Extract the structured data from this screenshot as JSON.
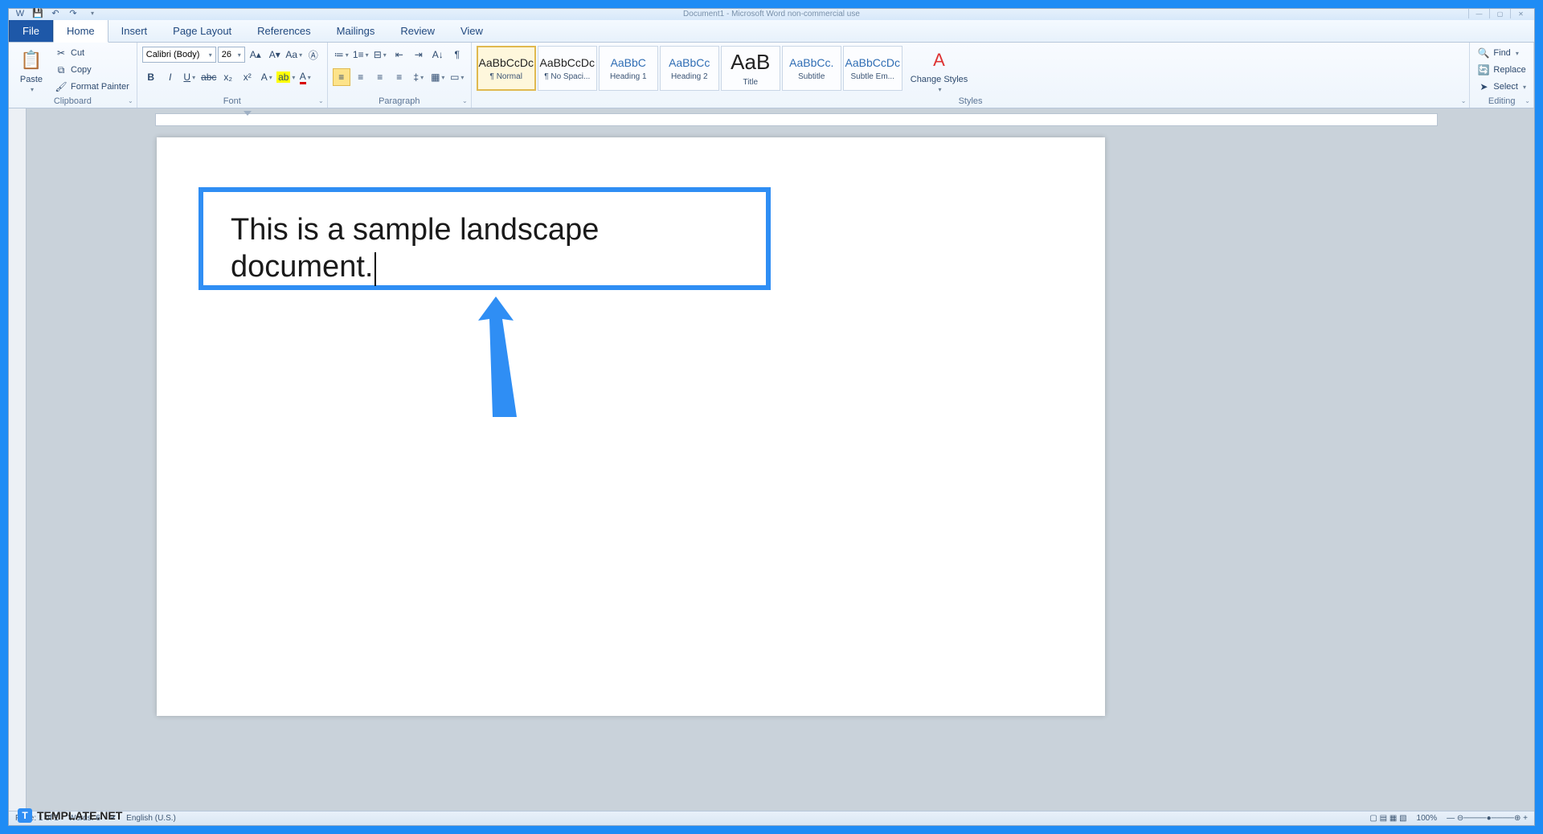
{
  "title": "Document1 - Microsoft Word non-commercial use",
  "tabs": {
    "file": "File",
    "home": "Home",
    "insert": "Insert",
    "pageLayout": "Page Layout",
    "references": "References",
    "mailings": "Mailings",
    "review": "Review",
    "view": "View"
  },
  "clipboard": {
    "paste": "Paste",
    "cut": "Cut",
    "copy": "Copy",
    "formatPainter": "Format Painter",
    "label": "Clipboard"
  },
  "font": {
    "name": "Calibri (Body)",
    "size": "26",
    "label": "Font"
  },
  "paragraph": {
    "label": "Paragraph"
  },
  "styles": {
    "label": "Styles",
    "items": [
      {
        "preview": "AaBbCcDc",
        "name": "¶ Normal",
        "sel": true,
        "cls": ""
      },
      {
        "preview": "AaBbCcDc",
        "name": "¶ No Spaci...",
        "cls": ""
      },
      {
        "preview": "AaBbC",
        "name": "Heading 1",
        "cls": "blue"
      },
      {
        "preview": "AaBbCc",
        "name": "Heading 2",
        "cls": "blue"
      },
      {
        "preview": "AaB",
        "name": "Title",
        "cls": "big"
      },
      {
        "preview": "AaBbCc.",
        "name": "Subtitle",
        "cls": "blue"
      },
      {
        "preview": "AaBbCcDc",
        "name": "Subtle Em...",
        "cls": "blue"
      }
    ],
    "change": "Change Styles"
  },
  "editing": {
    "find": "Find",
    "replace": "Replace",
    "select": "Select",
    "label": "Editing"
  },
  "document": {
    "text": "This is a sample landscape document."
  },
  "status": {
    "page": "Page: 1 of 1",
    "words": "Words: 6",
    "lang": "English (U.S.)",
    "zoom": "100%"
  },
  "watermark": "TEMPLATE.NET"
}
